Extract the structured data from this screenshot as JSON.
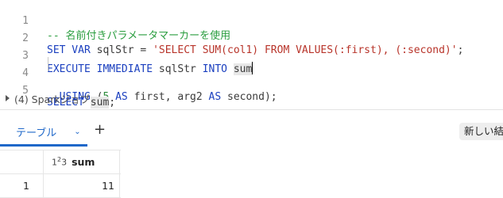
{
  "editor": {
    "lines": [
      {
        "num": "1"
      },
      {
        "num": "2"
      },
      {
        "num": "3"
      },
      {
        "num": "4"
      },
      {
        "num": "5"
      }
    ],
    "tokens": {
      "l1_comment": "-- 名前付きパラメータマーカーを使用",
      "l2_kw1": "SET VAR",
      "l2_id": " sqlStr = ",
      "l2_str": "'SELECT SUM(col1) FROM VALUES(:first), (:second)'",
      "l2_end": ";",
      "l3_kw1": "EXECUTE IMMEDIATE",
      "l3_id": " sqlStr ",
      "l3_kw2": "INTO",
      "l3_sp": " ",
      "l3_hl": "sum",
      "l4_kw1": "  USING",
      "l4_p1": " (",
      "l4_num": "5",
      "l4_sp": " ",
      "l4_kw2": "AS",
      "l4_id1": " first, arg2 ",
      "l4_kw3": "AS",
      "l4_id2": " second);",
      "l5_kw": "SELECT",
      "l5_sp": " ",
      "l5_hl": "sum",
      "l5_end": ";"
    }
  },
  "jobs": {
    "label": "(4) Sparkジョブ"
  },
  "results": {
    "tab_label": "テーブル",
    "add_label": "+",
    "new_result_label": "新しい結果",
    "columns": {
      "index_header": "",
      "sum_header": "sum",
      "sum_type": "1²₃"
    },
    "rows": [
      {
        "index": "1",
        "sum": "11"
      }
    ]
  }
}
